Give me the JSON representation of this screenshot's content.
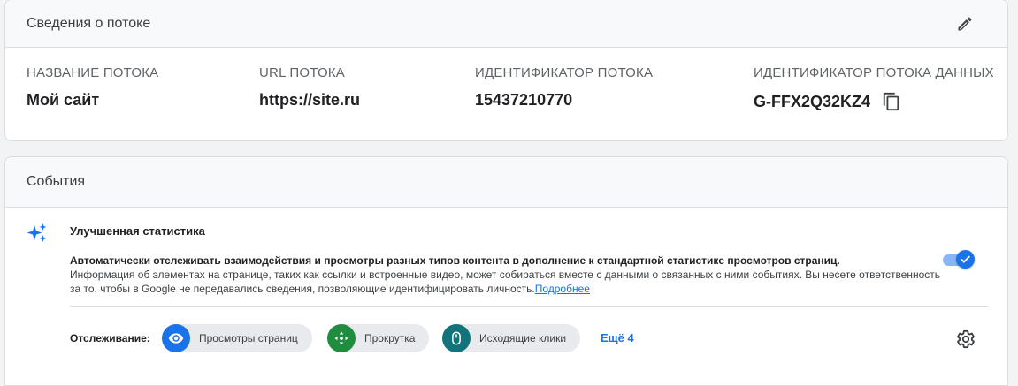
{
  "stream_details": {
    "title": "Сведения о потоке",
    "fields": [
      {
        "label": "НАЗВАНИЕ ПОТОКА",
        "value": "Мой сайт"
      },
      {
        "label": "URL ПОТОКА",
        "value": "https://site.ru"
      },
      {
        "label": "ИДЕНТИФИКАТОР ПОТОКА",
        "value": "15437210770"
      },
      {
        "label": "ИДЕНТИФИКАТОР ПОТОКА ДАННЫХ",
        "value": "G-FFX2Q32KZ4"
      }
    ]
  },
  "events": {
    "title": "События",
    "enhanced": {
      "title": "Улучшенная статистика",
      "desc_strong": "Автоматически отслеживать взаимодействия и просмотры разных типов контента в дополнение к стандартной статистике просмотров страниц.",
      "desc": "Информация об элементах на странице, таких как ссылки и встроенные видео, может собираться вместе с данными о связанных с ними событиях. Вы несете ответственность за то, чтобы в Google не передавались сведения, позволяющие идентифицировать личность.",
      "link": "Подробнее",
      "enabled": true
    },
    "tracking": {
      "label": "Отслеживание:",
      "chips": [
        {
          "label": "Просмотры страниц",
          "icon": "eye-icon",
          "color": "#1a73e8"
        },
        {
          "label": "Прокрутка",
          "icon": "scroll-arrows-icon",
          "color": "#1e8e3e"
        },
        {
          "label": "Исходящие клики",
          "icon": "mouse-icon",
          "color": "#12737b"
        }
      ],
      "more": "Ещё 4"
    }
  },
  "icons": {
    "edit": "pencil-icon",
    "copy": "copy-icon",
    "sparkle": "sparkle-icon",
    "settings": "gear-icon"
  },
  "colors": {
    "accent": "#1a73e8",
    "toggle_track": "#8ab4f8"
  }
}
